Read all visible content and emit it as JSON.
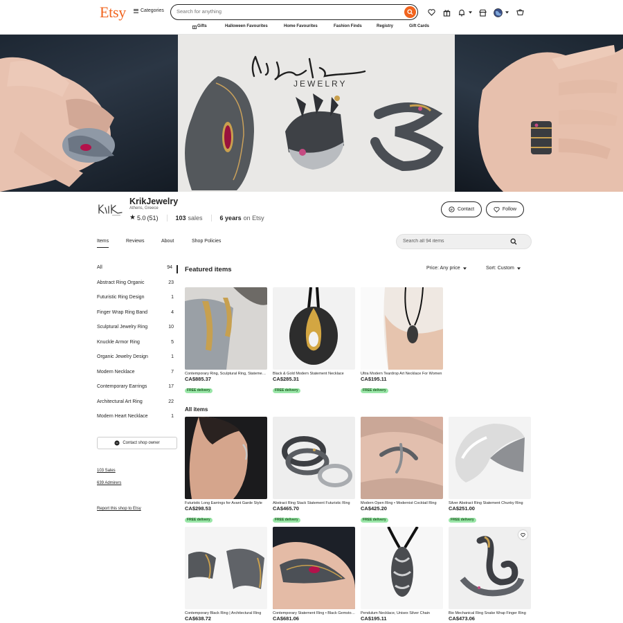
{
  "header": {
    "logo": "Etsy",
    "categories_label": "Categories",
    "search_placeholder": "Search for anything",
    "subnav": [
      "Gifts",
      "Halloween Favourites",
      "Home Favourites",
      "Fashion Finds",
      "Registry",
      "Gift Cards"
    ]
  },
  "banner": {
    "brand_signature": "Krik",
    "brand_subtitle": "JEWELRY"
  },
  "shop": {
    "name": "KrikJewelry",
    "location": "Athens, Greece",
    "rating": "5.0",
    "review_count": "(51)",
    "sales_value": "103",
    "sales_word": "sales",
    "years_value": "6 years",
    "years_word": "on Etsy",
    "contact_label": "Contact",
    "follow_label": "Follow"
  },
  "tabs": [
    "Items",
    "Reviews",
    "About",
    "Shop Policies"
  ],
  "shop_search_placeholder": "Search all 94 items",
  "sidebar": {
    "categories": [
      {
        "label": "All",
        "count": "94"
      },
      {
        "label": "Abstract Ring Organic",
        "count": "23"
      },
      {
        "label": "Futuristic Ring Design",
        "count": "1"
      },
      {
        "label": "Finger Wrap Ring Band",
        "count": "4"
      },
      {
        "label": "Sculptural Jewelry Ring",
        "count": "10"
      },
      {
        "label": "Knuckle Armor Ring",
        "count": "5"
      },
      {
        "label": "Organic Jewelry Design",
        "count": "1"
      },
      {
        "label": "Modern Necklace",
        "count": "7"
      },
      {
        "label": "Contemporary Earrings",
        "count": "17"
      },
      {
        "label": "Architectural Art Ring",
        "count": "22"
      },
      {
        "label": "Modern Heart Necklace",
        "count": "1"
      }
    ],
    "contact_owner": "Contact shop owner",
    "sales_link": "103 Sales",
    "admirers_link": "639 Admirers",
    "report_link": "Report this shop to Etsy"
  },
  "main": {
    "featured_title": "Featured items",
    "price_filter": "Price: Any price",
    "sort_filter": "Sort: Custom",
    "all_items_title": "All items",
    "free_delivery": "FREE delivery",
    "featured": [
      {
        "title": "Contemporary Ring, Sculptural Ring, Statement Ring",
        "price": "CA$885.37"
      },
      {
        "title": "Black & Gold Modern Statement Necklace",
        "price": "CA$285.31"
      },
      {
        "title": "Ultra Modern Teardrop Art Necklace For Women",
        "price": "CA$195.11"
      }
    ],
    "all_items": [
      {
        "title": "Futuristic Long Earrings for Avant Garde Style",
        "price": "CA$298.53"
      },
      {
        "title": "Abstract Ring Stack Statement Futuristic Ring",
        "price": "CA$465.70"
      },
      {
        "title": "Modern Open Ring • Modernist Cocktail Ring",
        "price": "CA$425.20"
      },
      {
        "title": "Silver Abstract Ring Statement Chunky Ring",
        "price": "CA$251.00"
      },
      {
        "title": "Contemporary Black Ring | Architectural Ring",
        "price": "CA$638.72"
      },
      {
        "title": "Contemporary Statement Ring • Black Gemstone Ring",
        "price": "CA$681.06"
      },
      {
        "title": "Pendulum Necklace, Unisex Silver Chain",
        "price": "CA$195.11"
      },
      {
        "title": "Bio Mechanical Ring Snake Wrap Finger Ring",
        "price": "CA$473.06"
      }
    ]
  },
  "colors": {
    "brand": "#f1641e",
    "free_badge": "#9ae6a8",
    "text": "#222222"
  }
}
